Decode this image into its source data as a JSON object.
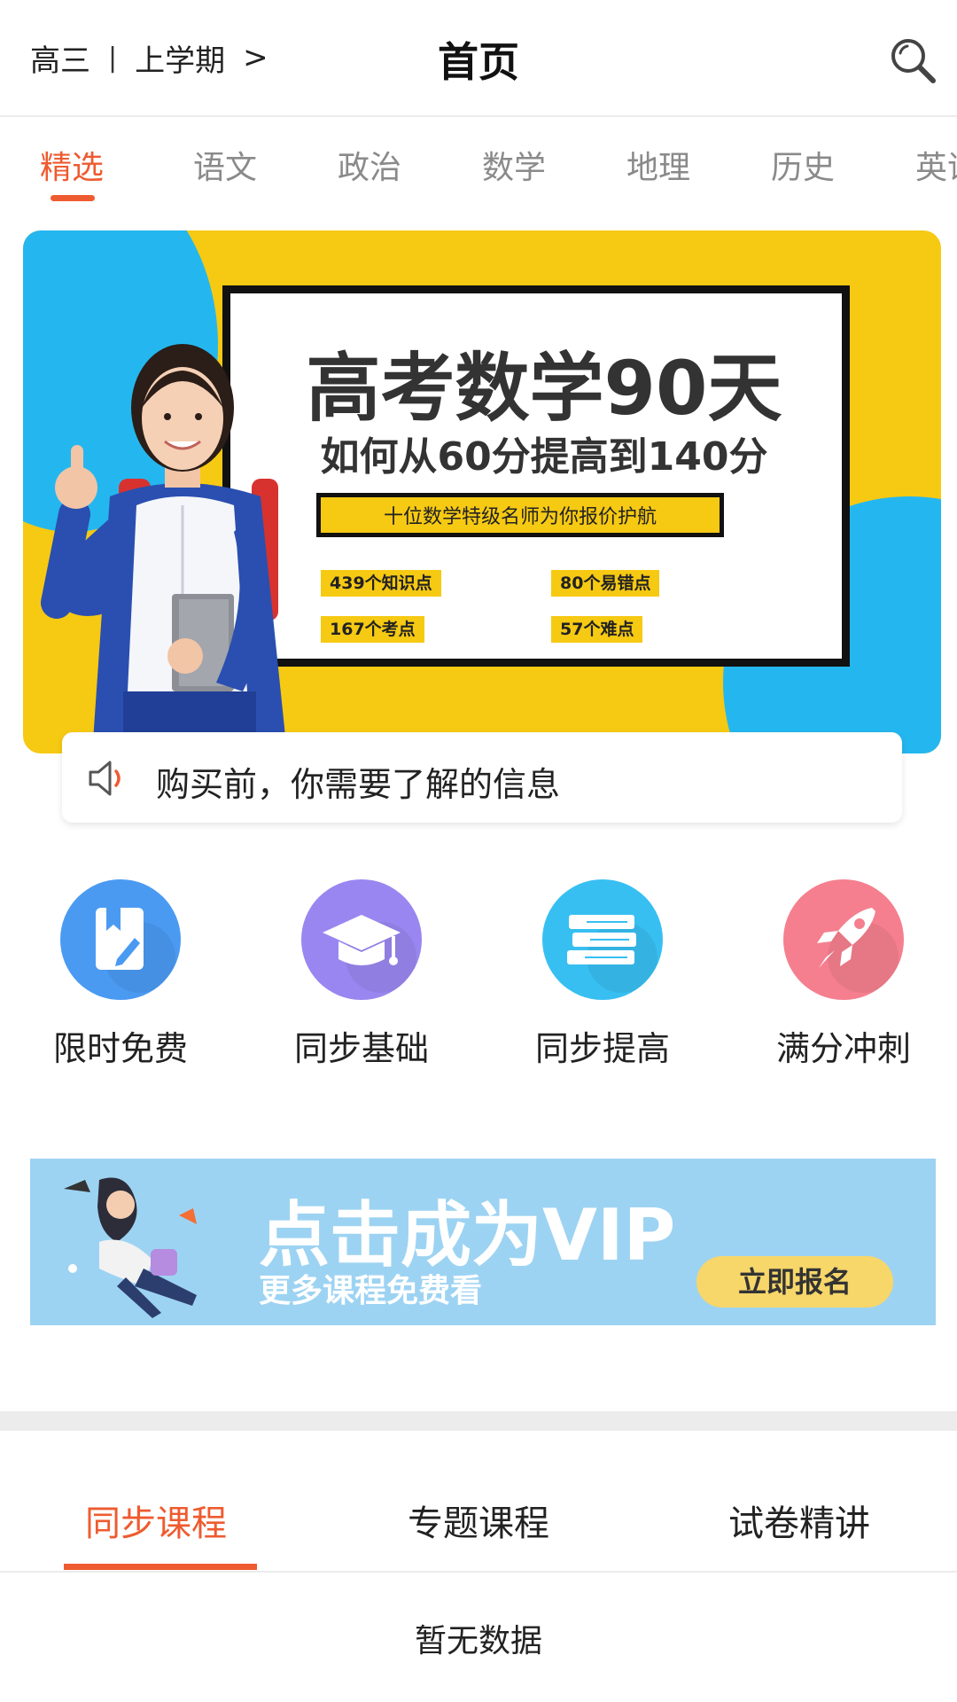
{
  "header": {
    "grade": "高三",
    "separator": "|",
    "term": "上学期",
    "chevron": ">",
    "title": "首页",
    "search_icon": "search-icon"
  },
  "tabs": [
    "精选",
    "语文",
    "政治",
    "数学",
    "地理",
    "历史",
    "英语"
  ],
  "active_tab": "精选",
  "banner": {
    "headline": "高考数学90天",
    "subline": "如何从60分提高到140分",
    "boxed_text": "十位数学特级名师为你报价护航",
    "tags": [
      "439个知识点",
      "80个易错点",
      "167个考点",
      "57个难点"
    ]
  },
  "notice": {
    "icon": "speaker-icon",
    "text": "购买前，你需要了解的信息"
  },
  "features": [
    {
      "label": "限时免费",
      "icon": "bookmark-pencil-icon",
      "color": "#4a9af2"
    },
    {
      "label": "同步基础",
      "icon": "graduation-cap-icon",
      "color": "#9a86f0"
    },
    {
      "label": "同步提高",
      "icon": "book-stack-icon",
      "color": "#38bff2"
    },
    {
      "label": "满分冲刺",
      "icon": "rocket-icon",
      "color": "#f57f8e"
    }
  ],
  "vip": {
    "title": "点击成为VIP",
    "subtitle": "更多课程免费看",
    "button": "立即报名"
  },
  "bottom_tabs": [
    "同步课程",
    "专题课程",
    "试卷精讲"
  ],
  "active_bottom_tab": "同步课程",
  "empty_text": "暂无数据",
  "colors": {
    "accent": "#ee5b30",
    "banner_yellow": "#f6c913",
    "banner_blue": "#24b7ef",
    "vip_bg": "#9dd3f2"
  }
}
